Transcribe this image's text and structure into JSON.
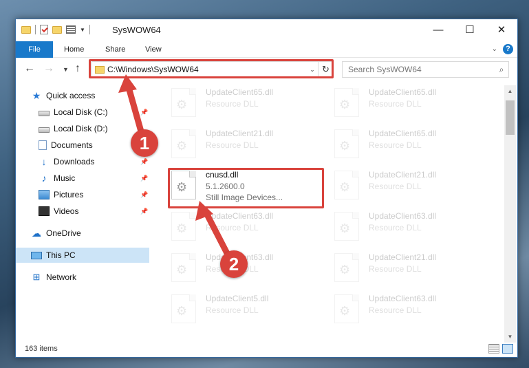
{
  "window": {
    "title": "SysWOW64",
    "controls": {
      "minimize": "—",
      "maximize": "☐",
      "close": "✕"
    }
  },
  "ribbon": {
    "tabs": [
      "File",
      "Home",
      "Share",
      "View"
    ]
  },
  "nav": {
    "address": "C:\\Windows\\SysWOW64",
    "search_placeholder": "Search SysWOW64"
  },
  "sidebar": {
    "quick_access": "Quick access",
    "items": [
      {
        "label": "Local Disk (C:)",
        "icon": "disk-icon",
        "pinned": true
      },
      {
        "label": "Local Disk (D:)",
        "icon": "disk-icon",
        "pinned": false
      },
      {
        "label": "Documents",
        "icon": "documents-icon",
        "pinned": true
      },
      {
        "label": "Downloads",
        "icon": "downloads-icon",
        "pinned": true
      },
      {
        "label": "Music",
        "icon": "music-icon",
        "pinned": true
      },
      {
        "label": "Pictures",
        "icon": "pictures-icon",
        "pinned": true
      },
      {
        "label": "Videos",
        "icon": "videos-icon",
        "pinned": true
      }
    ],
    "onedrive": "OneDrive",
    "this_pc": "This PC",
    "network": "Network"
  },
  "files": [
    {
      "name": "UpdateClient65.dll",
      "sub": "Resource DLL"
    },
    {
      "name": "UpdateClient65.dll",
      "sub": "Resource DLL"
    },
    {
      "name": "UpdateClient21.dll",
      "sub": "Resource DLL"
    },
    {
      "name": "UpdateClient65.dll",
      "sub": "Resource DLL"
    },
    {
      "name": "cnusd.dll",
      "sub": "5.1.2600.0",
      "sub2": "Still Image Devices..."
    },
    {
      "name": "UpdateClient21.dll",
      "sub": "Resource DLL"
    },
    {
      "name": "UpdateClient63.dll",
      "sub": "Resource DLL"
    },
    {
      "name": "UpdateClient63.dll",
      "sub": "Resource DLL"
    },
    {
      "name": "UpdateClient63.dll",
      "sub": "Resource DLL"
    },
    {
      "name": "UpdateClient21.dll",
      "sub": "Resource DLL"
    },
    {
      "name": "UpdateClient5.dll",
      "sub": "Resource DLL"
    },
    {
      "name": "UpdateClient63.dll",
      "sub": "Resource DLL"
    }
  ],
  "status": {
    "item_count": "163 items"
  },
  "callouts": {
    "step1": "1",
    "step2": "2"
  },
  "colors": {
    "accent": "#1979ca",
    "highlight": "#d9433c",
    "selected": "#cce4f7"
  }
}
